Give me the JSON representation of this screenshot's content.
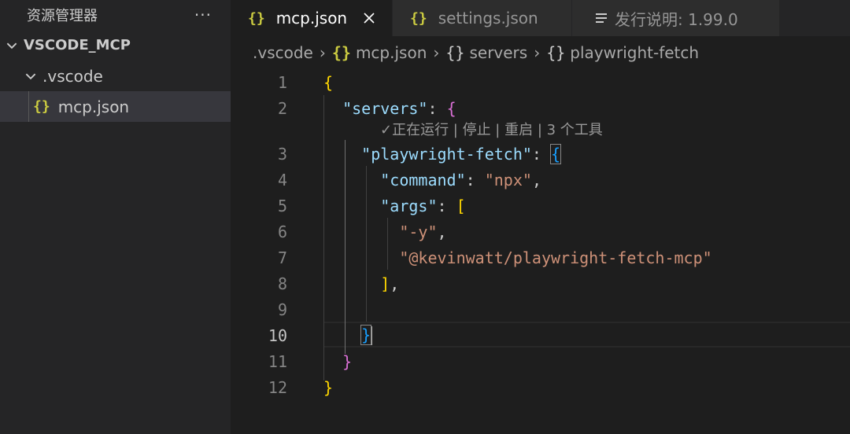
{
  "sidebar": {
    "title": "资源管理器",
    "more": "···",
    "root": "VSCODE_MCP",
    "folder": ".vscode",
    "file_icon": "{}",
    "file": "mcp.json"
  },
  "tabs": [
    {
      "icon": "{}",
      "label": "mcp.json",
      "active": true
    },
    {
      "icon": "{}",
      "label": "settings.json",
      "active": false
    },
    {
      "icon": "preview-icon",
      "label": "发行说明: 1.99.0",
      "active": false
    }
  ],
  "breadcrumb": {
    "folder": ".vscode",
    "file_icon": "{}",
    "file": "mcp.json",
    "obj_icon": "{}",
    "servers": "servers",
    "server": "playwright-fetch"
  },
  "editor": {
    "line_numbers": [
      "1",
      "2",
      "3",
      "4",
      "5",
      "6",
      "7",
      "8",
      "9",
      "10",
      "11",
      "12"
    ],
    "current_line": "10",
    "codelens": "✓正在运行 | 停止 | 重启 | 3 个工具",
    "code": {
      "open_brace": "{",
      "servers_key": "\"servers\"",
      "colon": ": ",
      "servers_open": "{",
      "pf_key": "\"playwright-fetch\"",
      "pf_open": "{",
      "command_key": "\"command\"",
      "command_val": "\"npx\"",
      "comma": ",",
      "args_key": "\"args\"",
      "args_open": "[",
      "arg1": "\"-y\"",
      "arg2": "\"@kevinwatt/playwright-fetch-mcp\"",
      "args_close": "]",
      "pf_close": "}",
      "servers_close": "}",
      "close_brace": "}"
    }
  },
  "colors": {
    "key": "#9cdcfe",
    "string": "#ce9178",
    "bracket1": "#ffd700",
    "bracket2": "#da70d6",
    "bracket3": "#179fff"
  }
}
